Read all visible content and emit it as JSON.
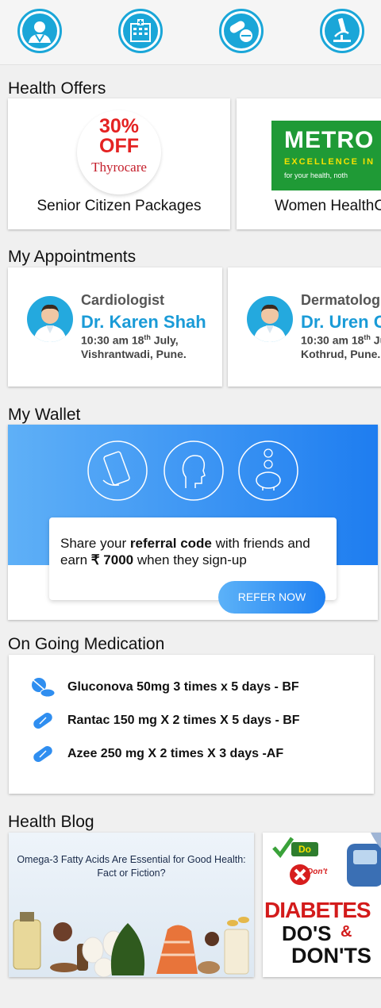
{
  "topnav": {
    "icons": [
      "doctor-icon",
      "hospital-icon",
      "pills-icon",
      "microscope-icon"
    ]
  },
  "offers": {
    "title": "Health Offers",
    "items": [
      {
        "label": "Senior Citizen Packages",
        "badge_top": "30%",
        "badge_mid": "OFF",
        "brand": "Thyrocare"
      },
      {
        "label": "Women HealthC",
        "brand": "METRO",
        "tagline": "EXCELLENCE IN",
        "sub": "for your health, noth"
      }
    ]
  },
  "appointments": {
    "title": "My Appointments",
    "items": [
      {
        "specialty": "Cardiologist",
        "doctor": "Dr. Karen Shah",
        "time": "10:30 am 18",
        "time_sup": "th",
        "time_rest": " July,",
        "place": "Vishrantwadi, Pune."
      },
      {
        "specialty": "Dermatolog",
        "doctor": "Dr. Uren C",
        "time": "10:30 am 18",
        "time_sup": "th",
        "time_rest": " Ju",
        "place": "Kothrud, Pune."
      }
    ]
  },
  "wallet": {
    "title": "My Wallet",
    "text_pre": "Share your ",
    "text_bold": "referral code",
    "text_mid": " with friends and earn ",
    "text_amount": "₹ 7000",
    "text_post": " when they sign-up",
    "button": "REFER NOW"
  },
  "medication": {
    "title": "On Going Medication",
    "items": [
      {
        "text": "Gluconova 50mg 3 times x 5 days - BF",
        "icon": "pills-icon"
      },
      {
        "text": "Rantac 150 mg X 2 times X 5 days - BF",
        "icon": "capsule-icon"
      },
      {
        "text": "Azee 250 mg X 2 times X 3 days -AF",
        "icon": "capsule-icon"
      }
    ]
  },
  "blog": {
    "title": "Health Blog",
    "items": [
      {
        "headline": "Omega-3 Fatty Acids Are Essential for Good Health: Fact or Fiction?"
      },
      {
        "do": "Do",
        "dont": "Don't",
        "title1": "DIABETES",
        "title2": "DO'S",
        "amp": "&",
        "title3": "DON'TS"
      }
    ]
  },
  "colors": {
    "accent": "#1aa6d8",
    "doctor_name": "#1a9bd7",
    "wallet_gradient": [
      "#5fb0f7",
      "#1e7df0"
    ]
  }
}
